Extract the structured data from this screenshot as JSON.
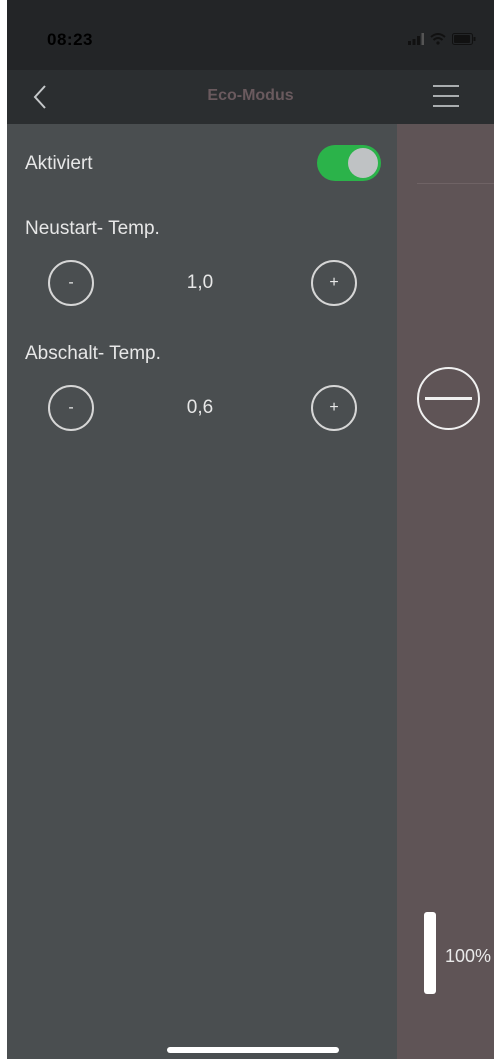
{
  "status_bar": {
    "time": "08:23"
  },
  "nav": {
    "title": "Eco-Modus"
  },
  "activated": {
    "label": "Aktiviert",
    "on": true
  },
  "restart": {
    "label": "Neustart- Temp.",
    "minus": "-",
    "value": "1,0",
    "plus": "+"
  },
  "shutoff": {
    "label": "Abschalt- Temp.",
    "minus": "-",
    "value": "0,6",
    "plus": "+"
  },
  "side": {
    "level": "100%"
  },
  "colors": {
    "accent": "#2bb34a",
    "panel": "#4a4e50",
    "side": "#5f5456",
    "title": "#6a5a5e"
  },
  "icons": [
    "back-chevron-icon",
    "menu-icon",
    "minus-circle-icon",
    "signal-icon",
    "wifi-icon",
    "battery-icon"
  ]
}
